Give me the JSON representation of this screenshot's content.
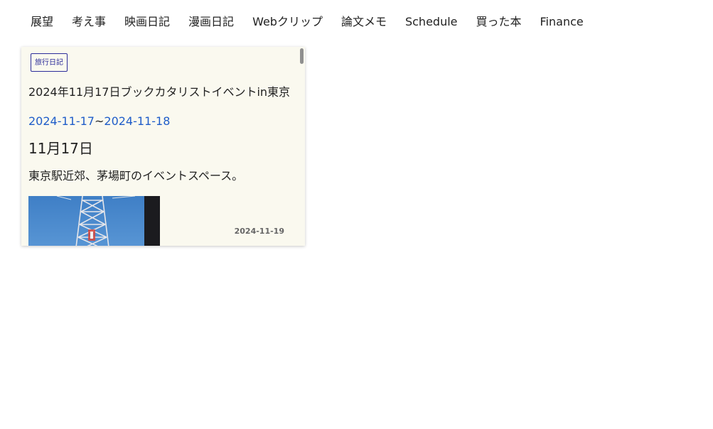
{
  "nav": {
    "items": [
      {
        "label": "展望"
      },
      {
        "label": "考え事"
      },
      {
        "label": "映画日記"
      },
      {
        "label": "漫画日記"
      },
      {
        "label": "Webクリップ"
      },
      {
        "label": "論文メモ"
      },
      {
        "label": "Schedule"
      },
      {
        "label": "買った本"
      },
      {
        "label": "Finance"
      }
    ]
  },
  "card": {
    "tag": "旅行日記",
    "title": "2024年11月17日ブックカタリストイベントin東京",
    "date_start": "2024-11-17",
    "date_sep": "~",
    "date_end": "2024-11-18",
    "subheading": "11月17日",
    "paragraph": "東京駅近郊、茅場町のイベントスペース。",
    "updated": "2024-11-19",
    "photo_icon": "tower-photo"
  },
  "colors": {
    "card_bg": "#faf9ef",
    "link": "#1f5dc9",
    "tag": "#2c2c9a"
  }
}
